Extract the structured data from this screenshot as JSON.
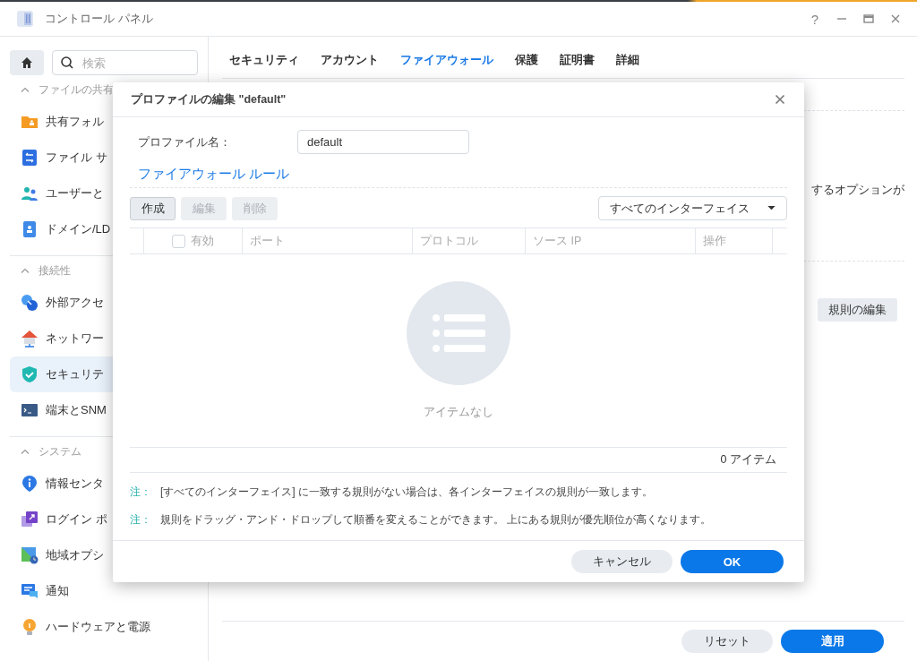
{
  "window": {
    "title": "コントロール パネル",
    "help": "?"
  },
  "sidebar": {
    "search": {
      "placeholder": "検索"
    },
    "sections": [
      {
        "title": "ファイルの共有",
        "expanded": true,
        "items": [
          {
            "label": "共有フォル",
            "selected": false
          },
          {
            "label": "ファイル サ",
            "selected": false
          },
          {
            "label": "ユーザーと",
            "selected": false
          },
          {
            "label": "ドメイン/LD",
            "selected": false
          }
        ]
      },
      {
        "title": "接続性",
        "expanded": true,
        "items": [
          {
            "label": "外部アクセ",
            "selected": false
          },
          {
            "label": "ネットワー",
            "selected": false
          },
          {
            "label": "セキュリテ",
            "selected": true
          },
          {
            "label": "端末とSNM",
            "selected": false
          }
        ]
      },
      {
        "title": "システム",
        "expanded": true,
        "items": [
          {
            "label": "情報センタ",
            "selected": false
          },
          {
            "label": "ログイン ポ",
            "selected": false
          },
          {
            "label": "地域オプシ",
            "selected": false
          },
          {
            "label": "通知",
            "selected": false
          },
          {
            "label": "ハードウェアと電源",
            "selected": false
          }
        ]
      }
    ]
  },
  "tabs": [
    {
      "label": "セキュリティ",
      "selected": false
    },
    {
      "label": "アカウント",
      "selected": false
    },
    {
      "label": "ファイアウォール",
      "selected": true
    },
    {
      "label": "保護",
      "selected": false
    },
    {
      "label": "証明書",
      "selected": false
    },
    {
      "label": "詳細",
      "selected": false
    }
  ],
  "panel": {
    "text": "するオプションが",
    "button": "規則の編集"
  },
  "footer": {
    "buttons": [
      {
        "label": "リセット",
        "primary": false
      },
      {
        "label": "適用",
        "primary": true
      }
    ]
  },
  "dialog": {
    "title": "プロファイルの編集 \"default\"",
    "profile_name": {
      "label": "プロファイル名：",
      "value": "default"
    },
    "section_title": "ファイアウォール ルール",
    "toolbar": {
      "buttons": [
        {
          "label": "作成",
          "disabled": false
        },
        {
          "label": "編集",
          "disabled": true
        },
        {
          "label": "削除",
          "disabled": true
        }
      ],
      "filter": {
        "value": "すべてのインターフェイス"
      }
    },
    "table": {
      "select_all": {
        "checked": false
      },
      "columns": [
        "有効",
        "ポート",
        "プロトコル",
        "ソース IP",
        "操作"
      ],
      "empty_text": "アイテムなし",
      "count": "0 アイテム"
    },
    "notes": [
      {
        "prefix": "注：",
        "text": "[すべてのインターフェイス] に一致する規則がない場合は、各インターフェイスの規則が一致します。"
      },
      {
        "prefix": "注：",
        "text": "規則をドラッグ・アンド・ドロップして順番を変えることができます。 上にある規則が優先順位が高くなります。"
      }
    ],
    "buttons": [
      {
        "label": "キャンセル",
        "primary": false
      },
      {
        "label": "OK",
        "primary": true
      }
    ]
  }
}
